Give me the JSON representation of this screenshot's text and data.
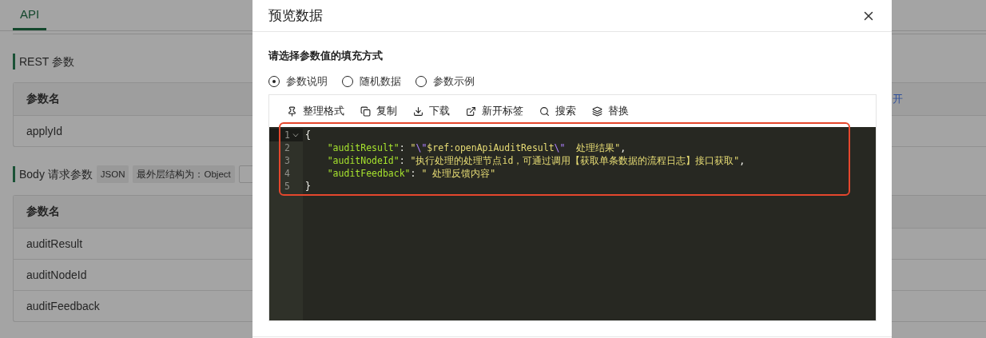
{
  "page": {
    "tab": {
      "label": "API",
      "selected": true
    },
    "sections": [
      {
        "title": "REST 参数",
        "table": {
          "header": "参数名",
          "header_link": "开",
          "rows": [
            "applyId"
          ]
        }
      },
      {
        "title": "Body 请求参数",
        "tags": [
          {
            "kind": "filled",
            "label": "JSON"
          },
          {
            "kind": "filled",
            "label": "最外层结构为：Object"
          },
          {
            "kind": "outlined"
          }
        ],
        "table": {
          "header": "参数名",
          "rows": [
            "auditResult",
            "auditNodeId",
            "auditFeedback"
          ]
        }
      }
    ]
  },
  "dialog": {
    "title": "预览数据",
    "fill_label": "请选择参数值的填充方式",
    "options": [
      {
        "label": "参数说明",
        "selected": true
      },
      {
        "label": "随机数据",
        "selected": false
      },
      {
        "label": "参数示例",
        "selected": false
      }
    ],
    "toolbar": [
      "整理格式",
      "复制",
      "下载",
      "新开标签",
      "搜索",
      "替换"
    ],
    "code_lines": [
      {
        "number": "1",
        "foldable": true,
        "active": true,
        "tokens": [
          {
            "kind": "punct",
            "text": "{"
          }
        ]
      },
      {
        "number": "2",
        "foldable": false,
        "active": false,
        "tokens": [
          {
            "kind": "key",
            "text": "    \"auditResult\""
          },
          {
            "kind": "punct",
            "text": ": "
          },
          {
            "kind": "string",
            "text": "\""
          },
          {
            "kind": "escape",
            "text": "\\\""
          },
          {
            "kind": "string",
            "text": "$ref:openApiAuditResult"
          },
          {
            "kind": "escape",
            "text": "\\\""
          },
          {
            "kind": "string",
            "text": "  处理结果\""
          },
          {
            "kind": "punct",
            "text": ","
          }
        ]
      },
      {
        "number": "3",
        "foldable": false,
        "active": false,
        "tokens": [
          {
            "kind": "key",
            "text": "    \"auditNodeId\""
          },
          {
            "kind": "punct",
            "text": ": "
          },
          {
            "kind": "string",
            "text": "\"执行处理的处理节点id，可通过调用【获取单条数据的流程日志】接口获取\""
          },
          {
            "kind": "punct",
            "text": ","
          }
        ]
      },
      {
        "number": "4",
        "foldable": false,
        "active": false,
        "tokens": [
          {
            "kind": "key",
            "text": "    \"auditFeedback\""
          },
          {
            "kind": "punct",
            "text": ": "
          },
          {
            "kind": "string",
            "text": "\" 处理反馈内容\""
          }
        ]
      },
      {
        "number": "5",
        "foldable": false,
        "active": false,
        "tokens": [
          {
            "kind": "punct",
            "text": "}"
          }
        ]
      }
    ],
    "highlight_frame": {
      "color": "#e5472d"
    }
  }
}
